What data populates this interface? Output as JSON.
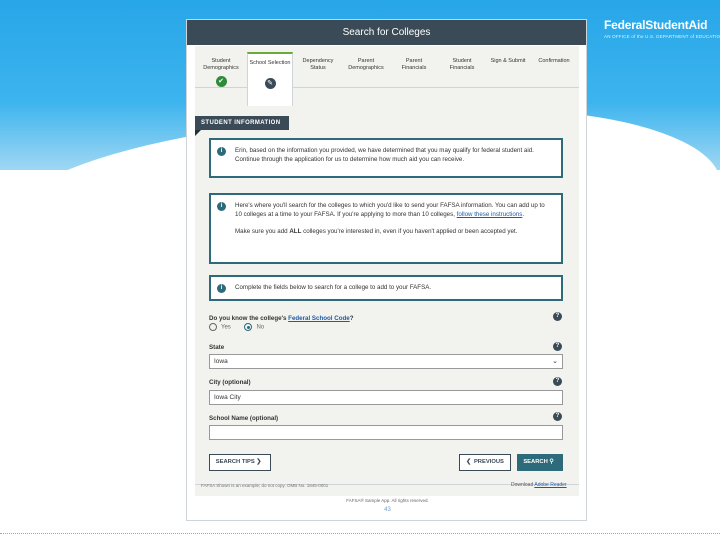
{
  "logo": {
    "name_bold": "Federal",
    "name_rest": "StudentAid",
    "tagline": "AN OFFICE of the U.S. DEPARTMENT of EDUCATION"
  },
  "window": {
    "title": "Search for Colleges"
  },
  "steps": [
    {
      "label1": "Student",
      "label2": "Demographics",
      "status": "done"
    },
    {
      "label1": "School Selection",
      "label2": "",
      "status": "current"
    },
    {
      "label1": "Dependency",
      "label2": "Status",
      "status": ""
    },
    {
      "label1": "Parent",
      "label2": "Demographics",
      "status": ""
    },
    {
      "label1": "Parent",
      "label2": "Financials",
      "status": ""
    },
    {
      "label1": "Student",
      "label2": "Financials",
      "status": ""
    },
    {
      "label1": "Sign & Submit",
      "label2": "",
      "status": ""
    },
    {
      "label1": "Confirmation",
      "label2": "",
      "status": ""
    }
  ],
  "section": {
    "title": "STUDENT INFORMATION"
  },
  "info": {
    "box1": "Erin, based on the information you provided, we have determined that you may qualify for federal student aid. Continue through the application for us to determine how much aid you can receive.",
    "box2_p1_a": "Here's where you'll search for the colleges to which you'd like to send your FAFSA information. You can add up to 10 colleges at a time to your FAFSA. If you're applying to more than 10 colleges, ",
    "box2_link": "follow these instructions",
    "box2_p1_b": ".",
    "box2_p2_a": "Make sure you add ",
    "box2_p2_bold": "ALL",
    "box2_p2_b": " colleges you're interested in, even if you haven't applied or been accepted yet.",
    "box3": "Complete the fields below to search for a college to add to your FAFSA."
  },
  "form": {
    "code_q_a": "Do you know the college's ",
    "code_q_link": "Federal School Code",
    "code_q_b": "?",
    "opt_yes": "Yes",
    "opt_no": "No",
    "state_label": "State",
    "state_value": "Iowa",
    "city_label": "City (optional)",
    "city_value": "Iowa City",
    "school_label": "School Name (optional)",
    "school_value": "",
    "help": "?"
  },
  "buttons": {
    "tips": "SEARCH TIPS",
    "tips_glyph": "❯",
    "previous": "PREVIOUS",
    "previous_glyph": "❮",
    "search": "SEARCH",
    "search_glyph": "⚲"
  },
  "footer": {
    "left": "FAFSA Shown is an example; do not copy. OMB No. 1845-0001",
    "right_a": "Download ",
    "right_link": "Adobe Reader",
    "center": "FAFSA® Sample App. All rights reserved.",
    "page": "43"
  }
}
